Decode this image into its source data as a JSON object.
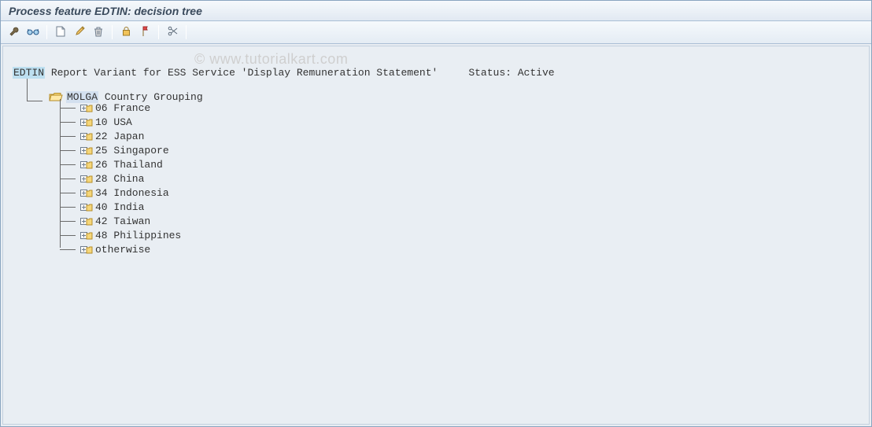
{
  "title": "Process feature EDTIN: decision tree",
  "watermark": "© www.tutorialkart.com",
  "root": {
    "code": "EDTIN",
    "description": "Report Variant for ESS Service 'Display Remuneration Statement'",
    "status_label": "Status:",
    "status_value": "Active"
  },
  "molga": {
    "code": "MOLGA",
    "label": "Country Grouping"
  },
  "children": [
    {
      "code": "06",
      "label": "France"
    },
    {
      "code": "10",
      "label": "USA"
    },
    {
      "code": "22",
      "label": "Japan"
    },
    {
      "code": "25",
      "label": "Singapore"
    },
    {
      "code": "26",
      "label": "Thailand"
    },
    {
      "code": "28",
      "label": "China"
    },
    {
      "code": "34",
      "label": "Indonesia"
    },
    {
      "code": "40",
      "label": "India"
    },
    {
      "code": "42",
      "label": "Taiwan"
    },
    {
      "code": "48",
      "label": "Philippines"
    },
    {
      "code": "otherwise",
      "label": ""
    }
  ],
  "toolbar": {
    "groups": [
      [
        "wrench",
        "glasses"
      ],
      [
        "new-doc",
        "pencil",
        "trash"
      ],
      [
        "lock",
        "flag"
      ],
      [
        "scissors"
      ]
    ]
  }
}
